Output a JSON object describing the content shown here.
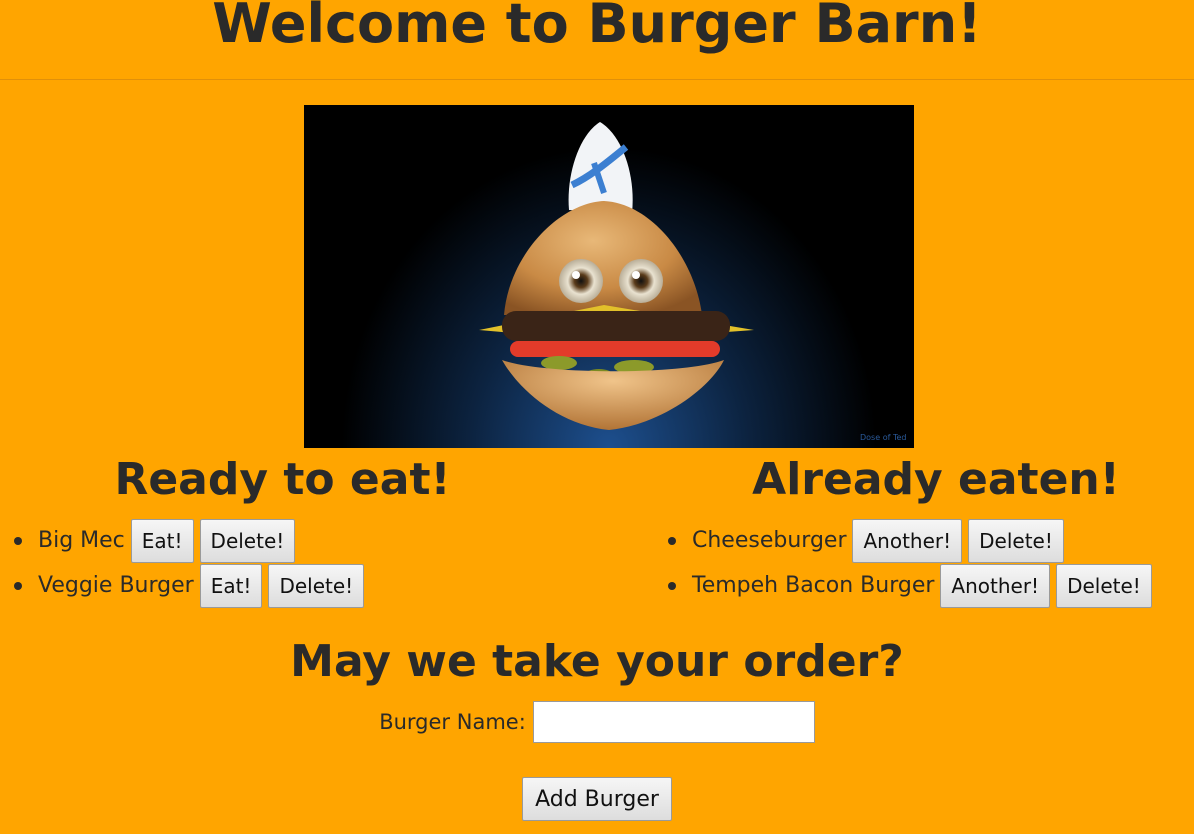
{
  "header": {
    "title": "Welcome to Burger Barn!"
  },
  "hero": {
    "alt": "Burger mascot with chef hat",
    "watermark": "Dose of Ted"
  },
  "ready": {
    "title": "Ready to eat!",
    "items": [
      {
        "name": "Big Mec",
        "eat_label": "Eat!",
        "delete_label": "Delete!"
      },
      {
        "name": "Veggie Burger",
        "eat_label": "Eat!",
        "delete_label": "Delete!"
      }
    ]
  },
  "eaten": {
    "title": "Already eaten!",
    "items": [
      {
        "name": "Cheeseburger",
        "another_label": "Another!",
        "delete_label": "Delete!"
      },
      {
        "name": "Tempeh Bacon Burger",
        "another_label": "Another!",
        "delete_label": "Delete!"
      }
    ]
  },
  "order": {
    "title": "May we take your order?",
    "field_label": "Burger Name:",
    "field_value": "",
    "submit_label": "Add Burger"
  },
  "colors": {
    "background": "#ffa500",
    "text": "#2a2a2a"
  }
}
